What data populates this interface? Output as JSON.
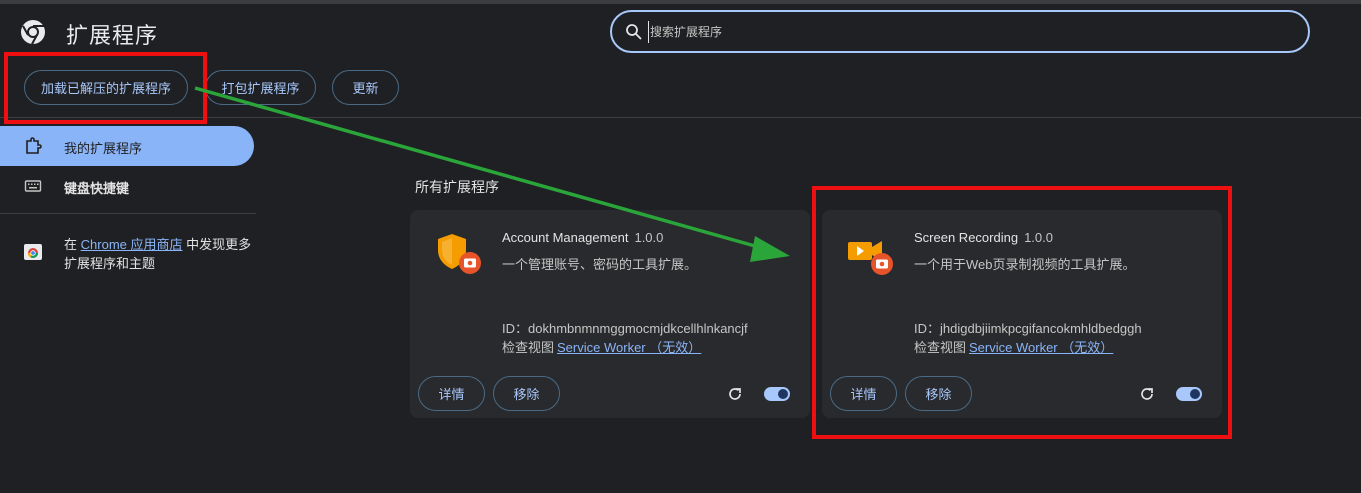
{
  "header": {
    "title": "扩展程序",
    "search_placeholder": "搜索扩展程序",
    "logo_icon": "chrome-logo-icon",
    "search_icon": "search-icon"
  },
  "toolbar": {
    "load_unpacked": "加载已解压的扩展程序",
    "pack": "打包扩展程序",
    "update": "更新"
  },
  "sidebar": {
    "items": [
      {
        "label": "我的扩展程序",
        "icon": "puzzle-icon",
        "active": true
      },
      {
        "label": "键盘快捷键",
        "icon": "keyboard-icon",
        "active": false
      }
    ],
    "store_prefix": "在",
    "store_link": "Chrome 应用商店",
    "store_suffix": "中发现更多扩展程序和主题"
  },
  "main": {
    "section_title": "所有扩展程序",
    "extensions": [
      {
        "name": "Account Management",
        "version": "1.0.0",
        "description": "一个管理账号、密码的工具扩展。",
        "id_text": "ID：dokhmbnmnmggmocmjdkcellhlnkancjf",
        "inspect_label": "检查视图",
        "inspect_link": "Service Worker （无效）",
        "detail_button": "详情",
        "remove_button": "移除",
        "enabled": true,
        "icon": "shield-badge-icon"
      },
      {
        "name": "Screen Recording",
        "version": "1.0.0",
        "description": "一个用于Web页录制视频的工具扩展。",
        "id_text": "ID：jhdigdbjiimkpcgifancokmhldbedggh",
        "inspect_label": "检查视图",
        "inspect_link": "Service Worker （无效）",
        "detail_button": "详情",
        "remove_button": "移除",
        "enabled": true,
        "icon": "video-camera-badge-icon"
      }
    ]
  },
  "colors": {
    "background": "#1f2023",
    "card": "#292a2d",
    "accent": "#a8c7fa",
    "active_nav": "#8ab4f8",
    "annotation_box": "#ee1010",
    "annotation_arrow": "#2aa53a",
    "icon_orange": "#f59c00",
    "badge_red": "#e8542a"
  }
}
